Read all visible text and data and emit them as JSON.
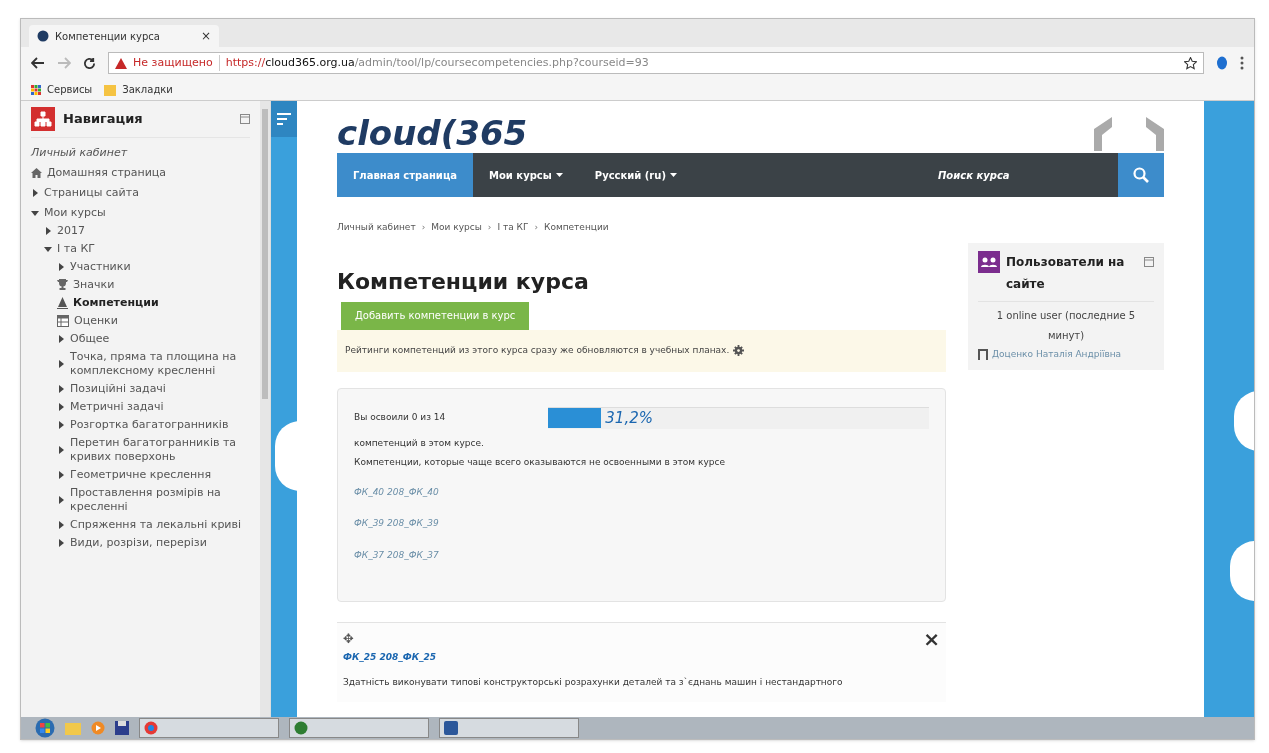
{
  "browser": {
    "tab": {
      "title": "Компетенции курса",
      "close": "×"
    },
    "security": "Не защищено",
    "url": {
      "scheme": "https://",
      "host": "cloud365.org.ua",
      "path": "/admin/tool/lp/coursecompetencies.php?courseid=93"
    },
    "bookmarks": [
      {
        "label": "Сервисы",
        "kind": "apps"
      },
      {
        "label": "Закладки",
        "kind": "folder"
      }
    ]
  },
  "sidebar": {
    "title": "Навигация",
    "items": [
      {
        "label": "Личный кабинет",
        "kind": "plain"
      },
      {
        "label": "Домашняя страница",
        "kind": "home"
      },
      {
        "label": "Страницы сайта",
        "kind": "branch",
        "expanded": false
      },
      {
        "label": "Мои курсы",
        "kind": "branch",
        "expanded": true,
        "children": [
          {
            "label": "2017",
            "kind": "branch",
            "expanded": false
          },
          {
            "label": "І та КГ",
            "kind": "branch",
            "expanded": true,
            "children": [
              {
                "label": "Участники",
                "kind": "branch",
                "expanded": false
              },
              {
                "label": "Значки",
                "kind": "trophy"
              },
              {
                "label": "Компетенции",
                "kind": "competency",
                "selected": true
              },
              {
                "label": "Оценки",
                "kind": "grades"
              },
              {
                "label": "Общее",
                "kind": "branch",
                "expanded": false
              },
              {
                "label": "Точка, пряма та площина на комплексному кресленні",
                "kind": "branch",
                "expanded": false
              },
              {
                "label": "Позиційні задачі",
                "kind": "branch",
                "expanded": false
              },
              {
                "label": "Метричні задачі",
                "kind": "branch",
                "expanded": false
              },
              {
                "label": "Розгортка багатогранників",
                "kind": "branch",
                "expanded": false
              },
              {
                "label": "Перетин багатогранників та кривих поверхонь",
                "kind": "branch",
                "expanded": false
              },
              {
                "label": "Геометричне креслення",
                "kind": "branch",
                "expanded": false
              },
              {
                "label": "Проставлення розмірів на кресленні",
                "kind": "branch",
                "expanded": false
              },
              {
                "label": "Спряження та лекальні криві",
                "kind": "branch",
                "expanded": false
              },
              {
                "label": "Види, розрізи, перерізи",
                "kind": "branch",
                "expanded": false
              }
            ]
          }
        ]
      }
    ]
  },
  "logo": "cloud(365",
  "navbar": {
    "items": [
      {
        "label": "Главная страница",
        "selected": true,
        "dropdown": false
      },
      {
        "label": "Мои курсы",
        "selected": false,
        "dropdown": true
      },
      {
        "label": "Русский (ru)",
        "selected": false,
        "dropdown": true
      }
    ],
    "search_placeholder": "Поиск курса"
  },
  "breadcrumb": {
    "separator": "›",
    "items": [
      "Личный кабинет",
      "Мои курсы",
      "І та КГ",
      "Компетенции"
    ]
  },
  "page_title": "Компетенции курса",
  "add_button": "Добавить компетенции в курс",
  "notice": "Рейтинги компетенций из этого курса сразу же обновляются в учебных планах.",
  "progress": {
    "line1": "Вы освоили 0 из 14",
    "line2": "компетенций в этом курсе.",
    "level": 0.14,
    "percent": "31,2%",
    "hint": "Компетенции, которые чаще всего оказываются не освоенными в этом курсе",
    "links": [
      "ФК_40 208_ФК_40",
      "ФК_39 208_ФК_39",
      "ФК_37 208_ФК_37"
    ]
  },
  "competency_card": {
    "move": "✥",
    "close": "×",
    "link": "ФК_25 208_ФК_25",
    "description": "Здатність виконувати типові конструкторські розрахунки деталей та з`єднань машин і нестандартного"
  },
  "online_block": {
    "title": "Пользователи на сайте",
    "summary": "1 online user (последние 5 минут)",
    "users": [
      "Доценко Наталія Андріївна"
    ]
  }
}
